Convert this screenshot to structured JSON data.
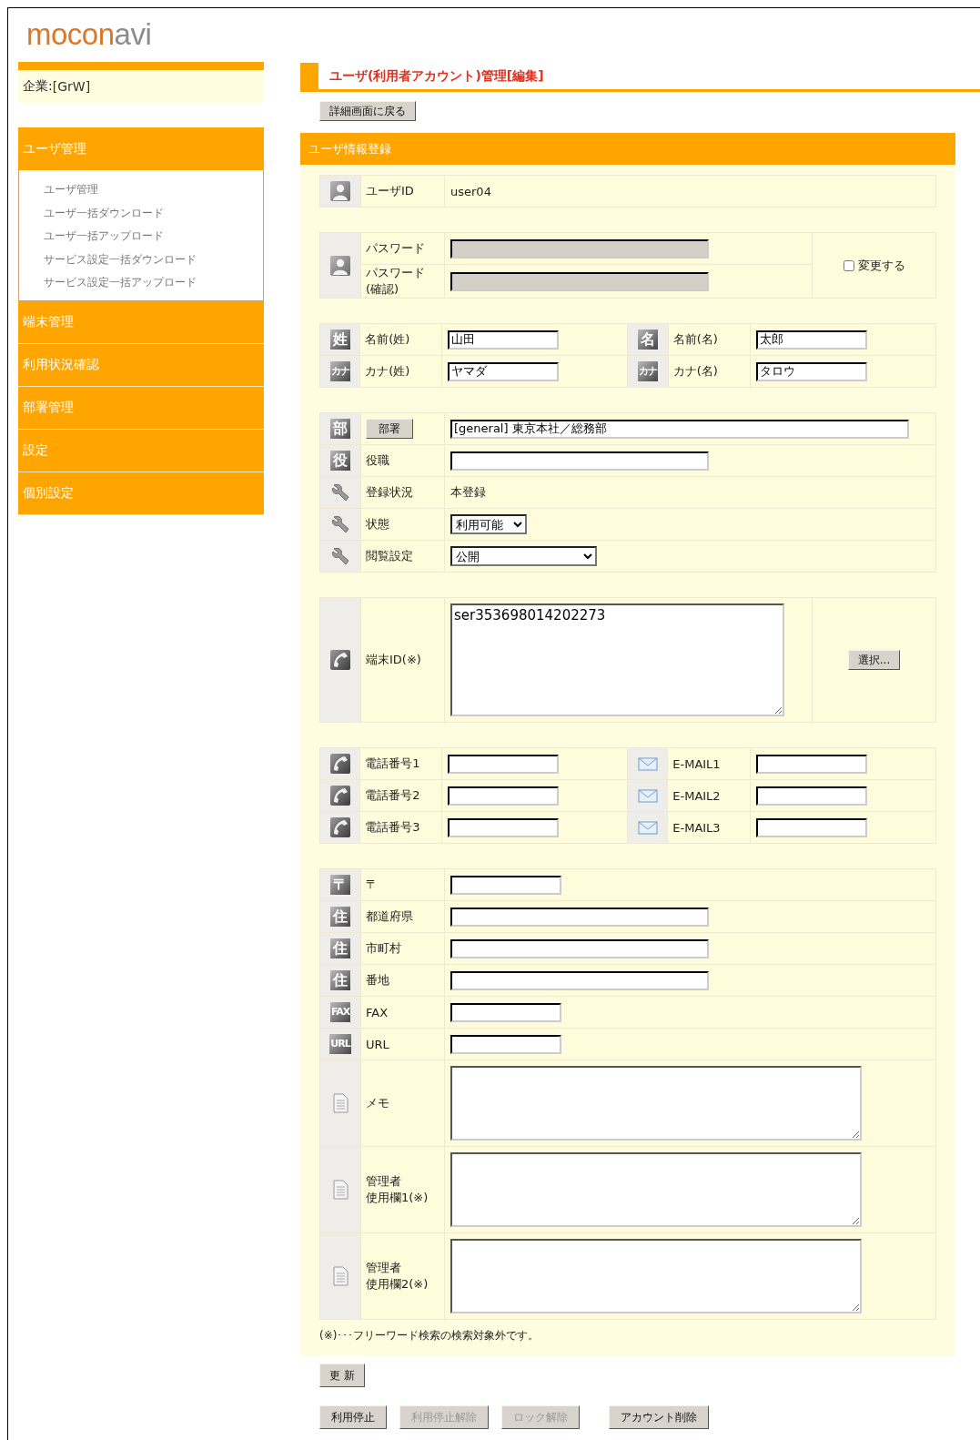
{
  "logo": [
    {
      "text": "mocon",
      "color": "#d9772a"
    },
    {
      "text": "avi",
      "color": "#8c8c8c"
    }
  ],
  "company": {
    "label": "企業:",
    "value": "[GrW]"
  },
  "sidebar": {
    "items": [
      {
        "label": "ユーザ管理",
        "expanded": true,
        "children": [
          {
            "label": "ユーザ管理"
          },
          {
            "label": "ユーザ一括ダウンロード"
          },
          {
            "label": "ユーザ一括アップロード"
          },
          {
            "label": "サービス設定一括ダウンロード"
          },
          {
            "label": "サービス設定一括アップロード"
          }
        ]
      },
      {
        "label": "端末管理",
        "expanded": false
      },
      {
        "label": "利用状況確認",
        "expanded": false
      },
      {
        "label": "部署管理",
        "expanded": false
      },
      {
        "label": "設定",
        "expanded": false
      },
      {
        "label": "個別設定",
        "expanded": false
      }
    ]
  },
  "page_title": "ユーザ(利用者アカウント)管理[編集]",
  "back_button": "詳細画面に戻る",
  "section_title": "ユーザ情報登録",
  "groups": [
    {
      "rows": [
        {
          "cells": [
            {
              "icon": {
                "kind": "person"
              },
              "label": "ユーザID",
              "field": {
                "kind": "text",
                "value": "user04"
              }
            }
          ]
        }
      ]
    },
    {
      "icon": {
        "kind": "person"
      },
      "side": {
        "kind": "checkbox",
        "label": "変更する",
        "checked": false
      },
      "rows": [
        {
          "cells": [
            {
              "label": "パスワード",
              "field": {
                "kind": "input_long",
                "disabled": true
              }
            }
          ]
        },
        {
          "cells": [
            {
              "label": [
                "パスワード",
                "(確認)"
              ],
              "field": {
                "kind": "input_long",
                "disabled": true
              }
            }
          ]
        }
      ]
    },
    {
      "rows": [
        {
          "cells": [
            {
              "icon": {
                "kind": "glyph",
                "text": "姓"
              },
              "label": "名前(姓)",
              "field": {
                "kind": "input_short",
                "value": "山田",
                "disabled": false
              }
            },
            {
              "icon": {
                "kind": "glyph",
                "text": "名"
              },
              "label": "名前(名)",
              "field": {
                "kind": "input_short",
                "value": "太郎",
                "disabled": false
              }
            }
          ]
        },
        {
          "cells": [
            {
              "icon": {
                "kind": "glyph",
                "text": "カナ"
              },
              "label": "カナ(姓)",
              "field": {
                "kind": "input_short",
                "value": "ヤマダ",
                "disabled": false
              }
            },
            {
              "icon": {
                "kind": "glyph",
                "text": "カナ"
              },
              "label": "カナ(名)",
              "field": {
                "kind": "input_short",
                "value": "タロウ",
                "disabled": false
              }
            }
          ]
        }
      ]
    },
    {
      "rows": [
        {
          "cells": [
            {
              "icon": {
                "kind": "glyph",
                "text": "部"
              },
              "label": "部署",
              "kind": "button",
              "field": {
                "kind": "input_wide",
                "value": "[general] 東京本社／総務部",
                "disabled": false
              }
            }
          ]
        },
        {
          "cells": [
            {
              "icon": {
                "kind": "glyph",
                "text": "役"
              },
              "label": "役職",
              "field": {
                "kind": "input_long",
                "disabled": false
              }
            }
          ]
        },
        {
          "cells": [
            {
              "icon": {
                "kind": "wrench"
              },
              "label": "登録状況",
              "field": {
                "kind": "text",
                "value": "本登録"
              }
            }
          ]
        },
        {
          "cells": [
            {
              "icon": {
                "kind": "wrench"
              },
              "label": "状態",
              "field": {
                "kind": "select_short",
                "value": "利用可能"
              }
            }
          ]
        },
        {
          "cells": [
            {
              "icon": {
                "kind": "wrench"
              },
              "label": "閲覧設定",
              "field": {
                "kind": "select_long",
                "value": "公開"
              }
            }
          ]
        }
      ]
    },
    {
      "side": {
        "kind": "button",
        "label": "選択..."
      },
      "rows": [
        {
          "cells": [
            {
              "icon": {
                "kind": "phone"
              },
              "label": "端末ID(※)",
              "field": {
                "kind": "textarea_tall",
                "value": "ser353698014202273",
                "disabled": false
              }
            }
          ]
        }
      ]
    },
    {
      "rows": [
        {
          "cells": [
            {
              "icon": {
                "kind": "phone"
              },
              "label": "電話番号1",
              "field": {
                "kind": "input_short",
                "disabled": false
              }
            },
            {
              "icon": {
                "kind": "mail"
              },
              "label": "E-MAIL1",
              "field": {
                "kind": "input_short",
                "disabled": false
              }
            }
          ]
        },
        {
          "cells": [
            {
              "icon": {
                "kind": "phone"
              },
              "label": "電話番号2",
              "field": {
                "kind": "input_short",
                "disabled": false
              }
            },
            {
              "icon": {
                "kind": "mail"
              },
              "label": "E-MAIL2",
              "field": {
                "kind": "input_short",
                "disabled": false
              }
            }
          ]
        },
        {
          "cells": [
            {
              "icon": {
                "kind": "phone"
              },
              "label": "電話番号3",
              "field": {
                "kind": "input_short",
                "disabled": false
              }
            },
            {
              "icon": {
                "kind": "mail"
              },
              "label": "E-MAIL3",
              "field": {
                "kind": "input_short",
                "disabled": false
              }
            }
          ]
        }
      ]
    },
    {
      "rows": [
        {
          "cells": [
            {
              "icon": {
                "kind": "glyph",
                "text": "〒"
              },
              "label": "〒",
              "field": {
                "kind": "input_short",
                "disabled": false
              }
            }
          ]
        },
        {
          "cells": [
            {
              "icon": {
                "kind": "glyph",
                "text": "住"
              },
              "label": "都道府県",
              "field": {
                "kind": "input_long",
                "disabled": false
              }
            }
          ]
        },
        {
          "cells": [
            {
              "icon": {
                "kind": "glyph",
                "text": "住"
              },
              "label": "市町村",
              "field": {
                "kind": "input_long",
                "disabled": false
              }
            }
          ]
        },
        {
          "cells": [
            {
              "icon": {
                "kind": "glyph",
                "text": "住"
              },
              "label": "番地",
              "field": {
                "kind": "input_long",
                "disabled": false
              }
            }
          ]
        },
        {
          "cells": [
            {
              "icon": {
                "kind": "glyph",
                "text": "FAX"
              },
              "label": "FAX",
              "field": {
                "kind": "input_short",
                "disabled": false
              }
            }
          ]
        },
        {
          "cells": [
            {
              "icon": {
                "kind": "glyph",
                "text": "URL"
              },
              "label": "URL",
              "field": {
                "kind": "input_short",
                "disabled": false
              }
            }
          ]
        },
        {
          "cells": [
            {
              "icon": {
                "kind": "document"
              },
              "label": "メモ",
              "field": {
                "kind": "textarea",
                "disabled": false
              }
            }
          ]
        },
        {
          "cells": [
            {
              "icon": {
                "kind": "document"
              },
              "label": [
                "管理者",
                "使用欄1(※)"
              ],
              "field": {
                "kind": "textarea",
                "disabled": false
              }
            }
          ]
        },
        {
          "cells": [
            {
              "icon": {
                "kind": "document"
              },
              "label": [
                "管理者",
                "使用欄2(※)"
              ],
              "field": {
                "kind": "textarea",
                "disabled": false
              }
            }
          ]
        }
      ]
    }
  ],
  "note": "(※)･･･フリーワード検索の検索対象外です。",
  "update_button": "更 新",
  "action_buttons": [
    [
      {
        "label": "利用停止",
        "disabled": false
      },
      {
        "label": "利用停止解除",
        "disabled": true
      },
      {
        "label": "ロック解除",
        "disabled": true
      }
    ],
    [
      {
        "label": "アカウント削除",
        "disabled": false
      }
    ]
  ]
}
